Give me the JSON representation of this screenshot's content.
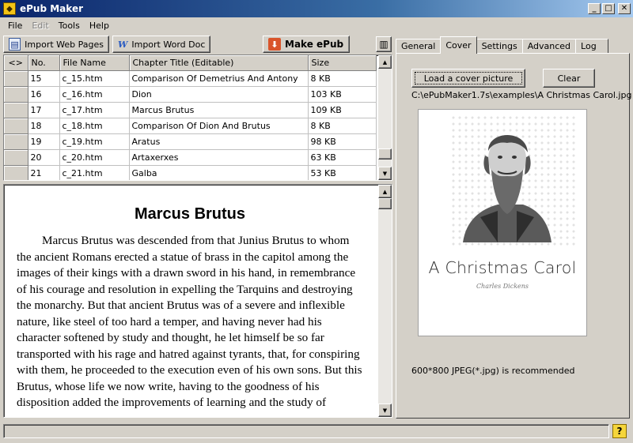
{
  "window": {
    "title": "ePub Maker",
    "icon": "epub-maker-logo-icon"
  },
  "menu": [
    {
      "label": "File",
      "enabled": true
    },
    {
      "label": "Edit",
      "enabled": false
    },
    {
      "label": "Tools",
      "enabled": true
    },
    {
      "label": "Help",
      "enabled": true
    }
  ],
  "toolbar": {
    "import_web": "Import Web Pages",
    "import_word": "Import Word Doc",
    "make_epub": "Make ePub"
  },
  "table": {
    "columns": [
      "<>",
      "No.",
      "File Name",
      "Chapter Title (Editable)",
      "Size"
    ],
    "rows": [
      {
        "no": "15",
        "file": "c_15.htm",
        "title": "Comparison Of Demetrius And Antony",
        "size": "8 KB"
      },
      {
        "no": "16",
        "file": "c_16.htm",
        "title": "Dion",
        "size": "103 KB"
      },
      {
        "no": "17",
        "file": "c_17.htm",
        "title": "Marcus Brutus",
        "size": "109 KB"
      },
      {
        "no": "18",
        "file": "c_18.htm",
        "title": "Comparison Of Dion And Brutus",
        "size": "8 KB"
      },
      {
        "no": "19",
        "file": "c_19.htm",
        "title": "Aratus",
        "size": "98 KB"
      },
      {
        "no": "20",
        "file": "c_20.htm",
        "title": "Artaxerxes",
        "size": "63 KB"
      },
      {
        "no": "21",
        "file": "c_21.htm",
        "title": "Galba",
        "size": "53 KB"
      }
    ]
  },
  "preview": {
    "heading": "Marcus Brutus",
    "paragraph": "Marcus Brutus was descended from that Junius Brutus to whom the ancient Romans erected a statue of brass in the capitol among the images of their kings with a drawn sword in his hand, in remembrance of his courage and resolution in expelling the Tarquins and destroying the monarchy. But that ancient Brutus was of a severe and inflexible nature, like steel of too hard a temper, and having never had his character softened by study and thought, he let himself be so far transported with his rage and hatred against tyrants, that, for conspiring with them, he proceeded to the execution even of his own sons. But this Brutus, whose life we now write, having to the goodness of his disposition added the improvements of learning and the study of"
  },
  "tabs": [
    "General",
    "Cover",
    "Settings",
    "Advanced",
    "Log"
  ],
  "active_tab": "Cover",
  "cover": {
    "load_button": "Load a cover picture",
    "clear_button": "Clear",
    "path": "C:\\ePubMaker1.7s\\examples\\A Christmas Carol.jpg",
    "image_title": "A Christmas Carol",
    "image_author": "Charles Dickens",
    "hint": "600*800 JPEG(*.jpg) is recommended"
  },
  "status": {
    "text": ""
  }
}
